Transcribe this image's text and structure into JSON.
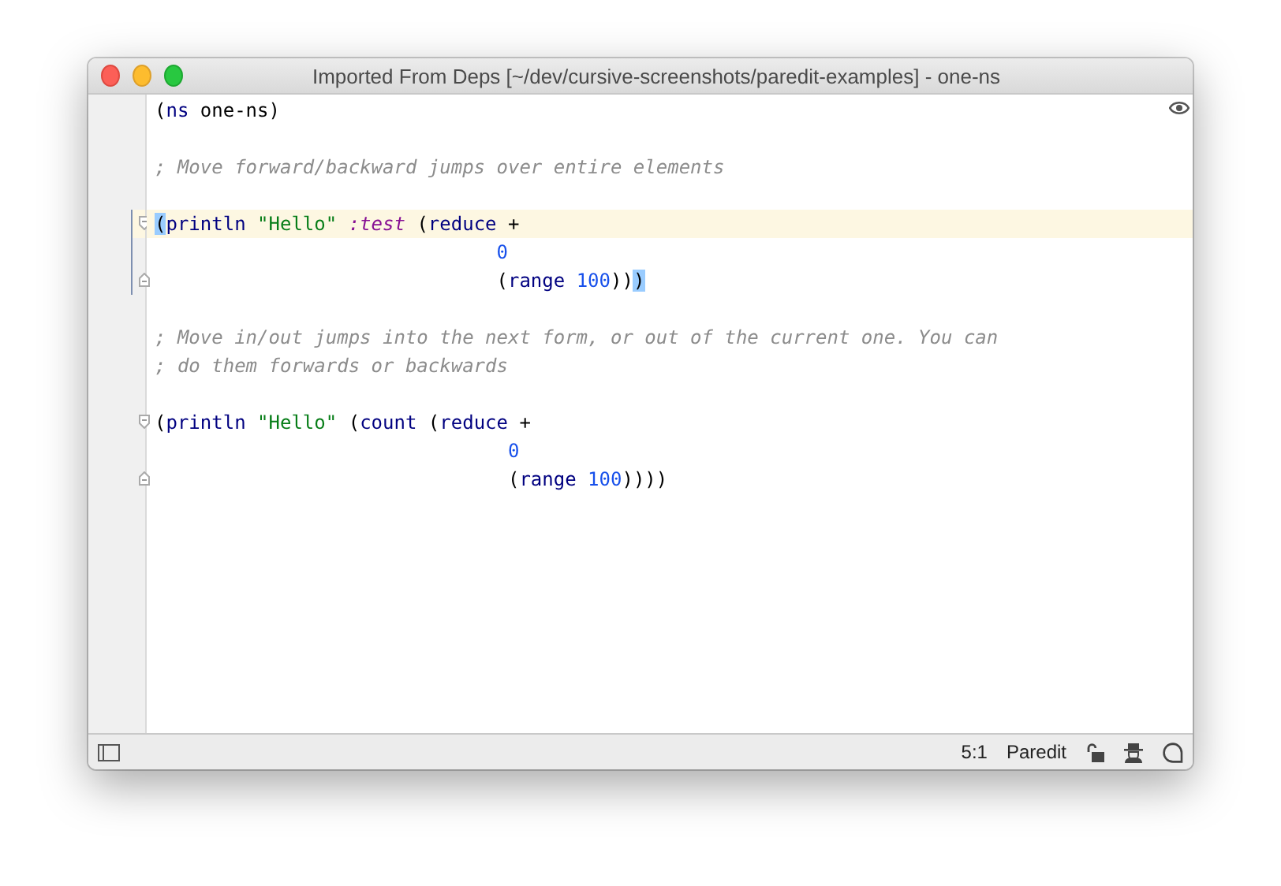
{
  "window": {
    "title": "Imported From Deps [~/dev/cursive-screenshots/paredit-examples] - one-ns"
  },
  "editor": {
    "lines": [
      {
        "current": false,
        "fold_start": false,
        "fold_end": false,
        "tokens": [
          {
            "kind": "plain",
            "text": "("
          },
          {
            "kind": "symbol",
            "text": "ns"
          },
          {
            "kind": "plain",
            "text": " one-ns)"
          }
        ]
      },
      {
        "current": false,
        "fold_start": false,
        "fold_end": false
      },
      {
        "current": false,
        "fold_start": false,
        "fold_end": false,
        "tokens": [
          {
            "kind": "comment",
            "text": "; Move forward/backward jumps over entire elements"
          }
        ]
      },
      {
        "current": false,
        "fold_start": false,
        "fold_end": false
      },
      {
        "current": true,
        "fold_start": true,
        "fold_end": false,
        "tokens": [
          {
            "kind": "matched",
            "text": "("
          },
          {
            "kind": "symbol",
            "text": "println"
          },
          {
            "kind": "string",
            "text": " \"Hello\""
          },
          {
            "kind": "keyword",
            "text": " :test"
          },
          {
            "kind": "plain",
            "text": " ("
          },
          {
            "kind": "symbol",
            "text": "reduce"
          },
          {
            "kind": "plain",
            "text": " +"
          }
        ]
      },
      {
        "current": false,
        "fold_start": false,
        "fold_end": false,
        "tokens": [
          {
            "kind": "number",
            "text": "                              0"
          }
        ]
      },
      {
        "current": false,
        "fold_start": false,
        "fold_end": true,
        "tokens": [
          {
            "kind": "plain",
            "text": "                              ("
          },
          {
            "kind": "symbol",
            "text": "range"
          },
          {
            "kind": "number",
            "text": " 100"
          },
          {
            "kind": "plain",
            "text": "))"
          },
          {
            "kind": "matched",
            "text": ")"
          }
        ]
      },
      {
        "current": false,
        "fold_start": false,
        "fold_end": false
      },
      {
        "current": false,
        "fold_start": false,
        "fold_end": false,
        "tokens": [
          {
            "kind": "comment",
            "text": "; Move in/out jumps into the next form, or out of the current one. You can"
          }
        ]
      },
      {
        "current": false,
        "fold_start": false,
        "fold_end": false,
        "tokens": [
          {
            "kind": "comment",
            "text": "; do them forwards or backwards"
          }
        ]
      },
      {
        "current": false,
        "fold_start": false,
        "fold_end": false
      },
      {
        "current": false,
        "fold_start": true,
        "fold_end": false,
        "tokens": [
          {
            "kind": "plain",
            "text": "("
          },
          {
            "kind": "symbol",
            "text": "println"
          },
          {
            "kind": "string",
            "text": " \"Hello\""
          },
          {
            "kind": "plain",
            "text": " ("
          },
          {
            "kind": "symbol",
            "text": "count"
          },
          {
            "kind": "plain",
            "text": " ("
          },
          {
            "kind": "symbol",
            "text": "reduce"
          },
          {
            "kind": "plain",
            "text": " +"
          }
        ]
      },
      {
        "current": false,
        "fold_start": false,
        "fold_end": false,
        "tokens": [
          {
            "kind": "number",
            "text": "                               0"
          }
        ]
      },
      {
        "current": false,
        "fold_start": false,
        "fold_end": true,
        "tokens": [
          {
            "kind": "plain",
            "text": "                               ("
          },
          {
            "kind": "symbol",
            "text": "range"
          },
          {
            "kind": "number",
            "text": " 100"
          },
          {
            "kind": "plain",
            "text": "))))"
          }
        ]
      }
    ]
  },
  "status_bar": {
    "position": "5:1",
    "mode": "Paredit"
  }
}
